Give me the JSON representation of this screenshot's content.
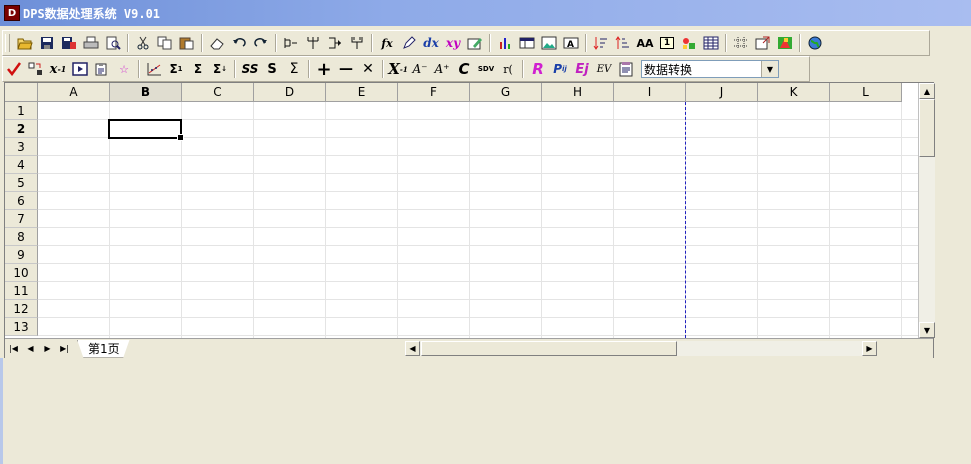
{
  "window": {
    "title": "DPS数据处理系统 V9.01",
    "icon_text": "D"
  },
  "toolbar1": {
    "icons": [
      "open-icon",
      "save-icon",
      "save-as-icon",
      "print-icon",
      "print-preview-icon",
      "cut-icon",
      "copy-icon",
      "paste-icon",
      "eraser-icon",
      "undo-icon",
      "redo-icon",
      "split-icon",
      "tree-icon",
      "merge-icon",
      "cluster-icon",
      "fx-icon",
      "pen-icon",
      "dx-icon",
      "xy-icon",
      "edit-icon",
      "bar-chart-icon",
      "table-icon",
      "image-icon",
      "text-box-icon",
      "sort-asc-icon",
      "sort-desc-icon",
      "font-size-icon",
      "number-one-icon",
      "shapes-icon",
      "grid-icon",
      "grid-lines-icon",
      "export-icon",
      "color-icon",
      "globe-icon"
    ],
    "labels": {
      "dx": "dx",
      "xy": "xy",
      "fx": "fx",
      "aa": "AA",
      "one": "1"
    }
  },
  "toolbar2": {
    "labels": {
      "ss": "SS",
      "s": "S",
      "sigma": "Σ",
      "plus": "+",
      "minus": "—",
      "times": "✕",
      "x2": "X",
      "a_minus": "A⁻",
      "a_plus": "A⁺",
      "c": "C",
      "sdv": "SDV",
      "rc": "r(",
      "r": "R",
      "p": "P",
      "ej": "Ej",
      "ev": "EV",
      "sigma1": "Σ",
      "sigma2": "Σ",
      "sigma3": "Σ"
    },
    "combo_value": "数据转换"
  },
  "sheet": {
    "columns": [
      "A",
      "B",
      "C",
      "D",
      "E",
      "F",
      "G",
      "H",
      "I",
      "J",
      "K",
      "L"
    ],
    "rows": [
      "1",
      "2",
      "3",
      "4",
      "5",
      "6",
      "7",
      "8",
      "9",
      "10",
      "11",
      "12",
      "13"
    ],
    "active_column": "B",
    "active_row": "2",
    "tab_label": "第1页"
  }
}
